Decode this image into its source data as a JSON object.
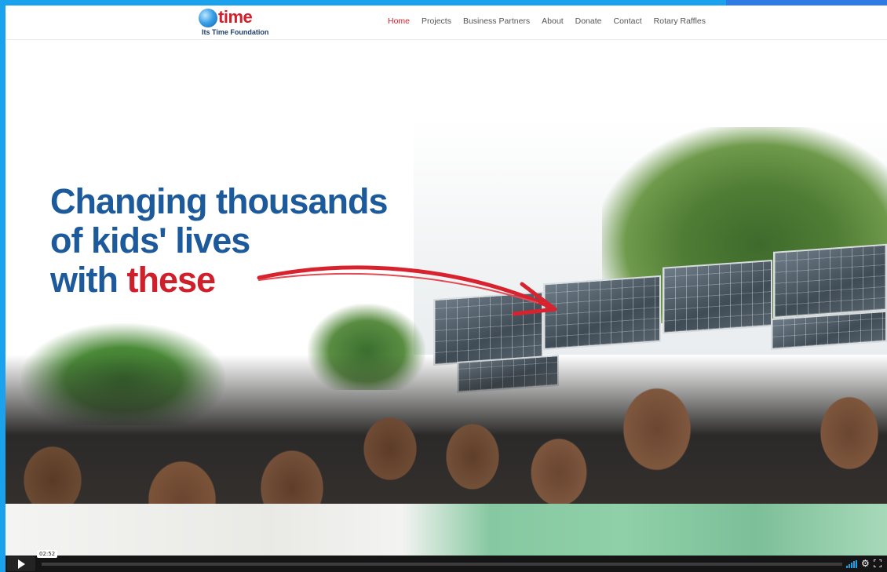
{
  "logo": {
    "word": "time",
    "subtitle": "Its Time Foundation"
  },
  "nav": {
    "items": [
      {
        "label": "Home",
        "active": true
      },
      {
        "label": "Projects",
        "active": false
      },
      {
        "label": "Business Partners",
        "active": false
      },
      {
        "label": "About",
        "active": false
      },
      {
        "label": "Donate",
        "active": false
      },
      {
        "label": "Contact",
        "active": false
      },
      {
        "label": "Rotary Raffles",
        "active": false
      }
    ]
  },
  "hero": {
    "headline_line1": "Changing thousands",
    "headline_line2": "of kids' lives",
    "headline_line3_prefix": "with ",
    "headline_line3_highlight": "these"
  },
  "video": {
    "time": "02:52",
    "progress": 0,
    "icons": [
      "play-icon",
      "volume-icon",
      "settings-icon",
      "fullscreen-icon"
    ]
  },
  "colors": {
    "accent_red": "#d21f2b",
    "headline_blue": "#1c5a9c",
    "frame_blue": "#1aa3ec",
    "volume_blue": "#19a0e6"
  }
}
